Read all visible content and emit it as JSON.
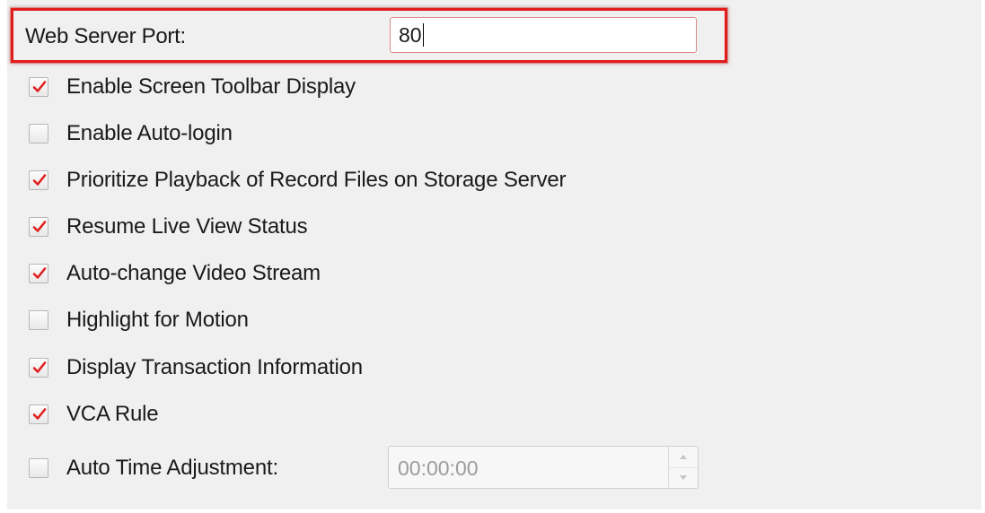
{
  "web_server_port": {
    "label": "Web Server Port:",
    "value": "80"
  },
  "options": [
    {
      "label": "Enable Screen Toolbar Display",
      "checked": true
    },
    {
      "label": "Enable Auto-login",
      "checked": false
    },
    {
      "label": "Prioritize Playback of Record Files on Storage Server",
      "checked": true
    },
    {
      "label": "Resume Live View Status",
      "checked": true
    },
    {
      "label": "Auto-change Video Stream",
      "checked": true
    },
    {
      "label": "Highlight for Motion",
      "checked": false
    },
    {
      "label": "Display Transaction Information",
      "checked": true
    },
    {
      "label": "VCA Rule",
      "checked": true
    },
    {
      "label": "Auto Time Adjustment:",
      "checked": false
    }
  ],
  "auto_time_adjustment": {
    "time_value": "00:00:00",
    "enabled": false
  },
  "colors": {
    "highlight_border": "#e21b1b",
    "check_mark": "#e02020",
    "panel_background": "#f0f0f0"
  }
}
